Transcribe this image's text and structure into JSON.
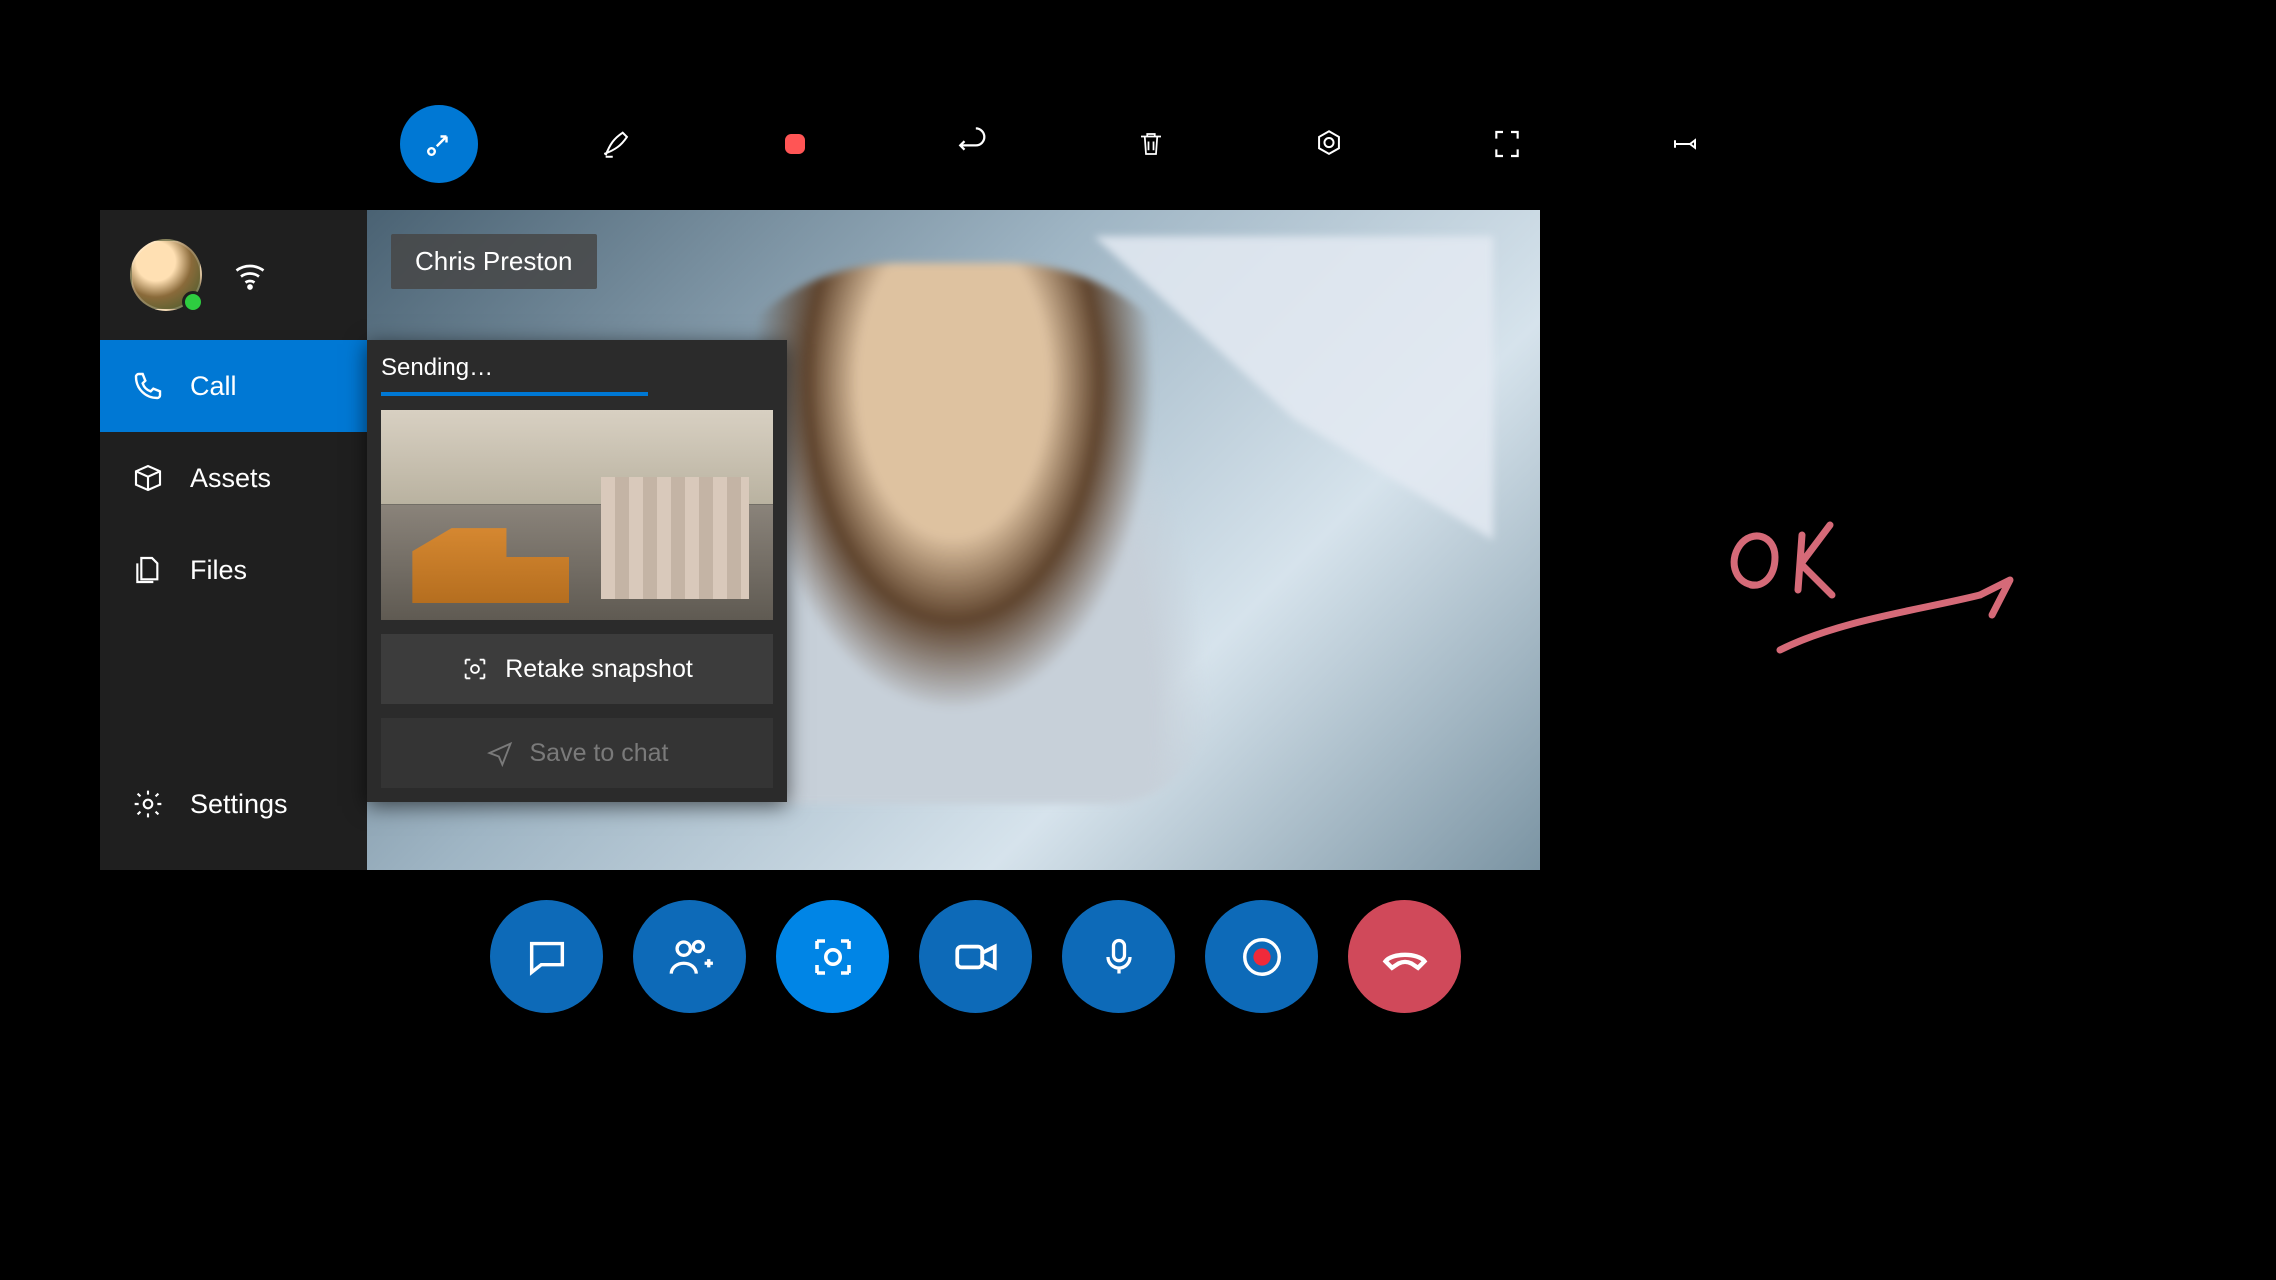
{
  "toolbar": {
    "active_index": 0,
    "items": [
      {
        "name": "collapse-icon"
      },
      {
        "name": "pen-icon"
      },
      {
        "name": "stop-record-icon"
      },
      {
        "name": "undo-icon"
      },
      {
        "name": "trash-icon"
      },
      {
        "name": "lens-icon"
      },
      {
        "name": "fullscreen-icon"
      },
      {
        "name": "pin-icon"
      }
    ]
  },
  "sidebar": {
    "items": [
      {
        "icon": "phone-icon",
        "label": "Call",
        "active": true
      },
      {
        "icon": "box-icon",
        "label": "Assets",
        "active": false
      },
      {
        "icon": "files-icon",
        "label": "Files",
        "active": false
      }
    ],
    "settings_label": "Settings"
  },
  "caller_name": "Chris Preston",
  "snapshot": {
    "status_label": "Sending…",
    "retake_label": "Retake snapshot",
    "save_label": "Save to chat",
    "progress_pct": 68
  },
  "callbar": {
    "items": [
      {
        "name": "chat-icon"
      },
      {
        "name": "add-person-icon"
      },
      {
        "name": "snapshot-icon",
        "active": true
      },
      {
        "name": "video-icon"
      },
      {
        "name": "mic-icon"
      },
      {
        "name": "record-icon"
      },
      {
        "name": "hangup-icon",
        "end": true
      }
    ]
  },
  "annotation_text": "OK",
  "colors": {
    "accent": "#0078d4",
    "end_call": "#d0495a",
    "record": "#f55"
  }
}
